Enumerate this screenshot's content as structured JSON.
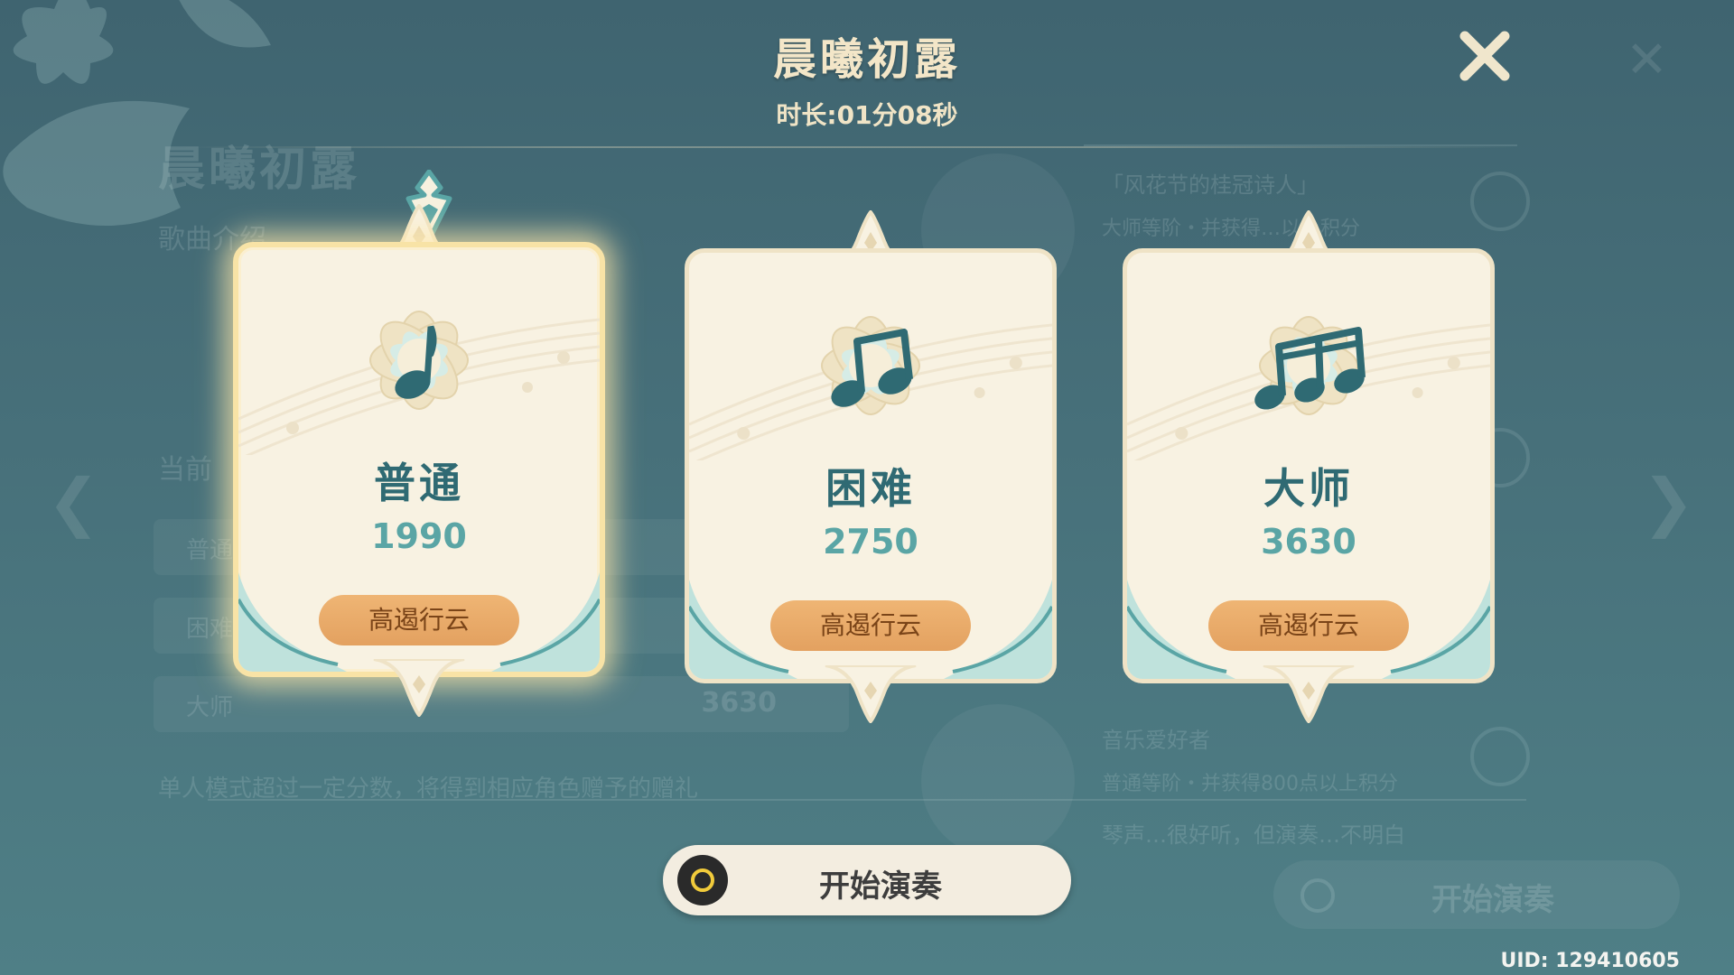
{
  "header": {
    "title": "晨曦初露",
    "duration": "时长:01分08秒",
    "close_icon": "close-icon"
  },
  "background": {
    "title": "晨曦初露",
    "intro_label": "歌曲介绍",
    "current_label": "当前",
    "rows": [
      {
        "label": "普通",
        "value": ""
      },
      {
        "label": "困难",
        "value": ""
      },
      {
        "label": "大师",
        "value": "3630"
      }
    ],
    "note": "单人模式超过一定分数，将得到相应角色赠予的赠礼",
    "achievements": [
      {
        "title": "「风花节的桂冠诗人」",
        "desc": "大师等阶・并获得…以上积分"
      },
      {
        "title": "音乐爱好者",
        "desc": "普通等阶・并获得800点以上积分"
      }
    ],
    "quote": "琴声…很好听，但演奏…不明白",
    "ghost_button": "开始演奏"
  },
  "difficulties": [
    {
      "name": "普通",
      "score": "1990",
      "badge": "高遏行云",
      "selected": true,
      "icon": "quarter-note-icon"
    },
    {
      "name": "困难",
      "score": "2750",
      "badge": "高遏行云",
      "selected": false,
      "icon": "double-note-icon"
    },
    {
      "name": "大师",
      "score": "3630",
      "badge": "高遏行云",
      "selected": false,
      "icon": "triple-note-icon"
    }
  ],
  "start_button": {
    "label": "开始演奏",
    "icon": "circle-button-icon"
  },
  "footer": {
    "uid": "UID: 129410605"
  },
  "colors": {
    "background": "#47707a",
    "card": "#f8f2e2",
    "accent_teal": "#2f6a73",
    "score_teal": "#5aa5a5",
    "badge": "#e8a96a",
    "title_cream": "#f3e6c8",
    "selected_glow": "#f8e3a6"
  }
}
